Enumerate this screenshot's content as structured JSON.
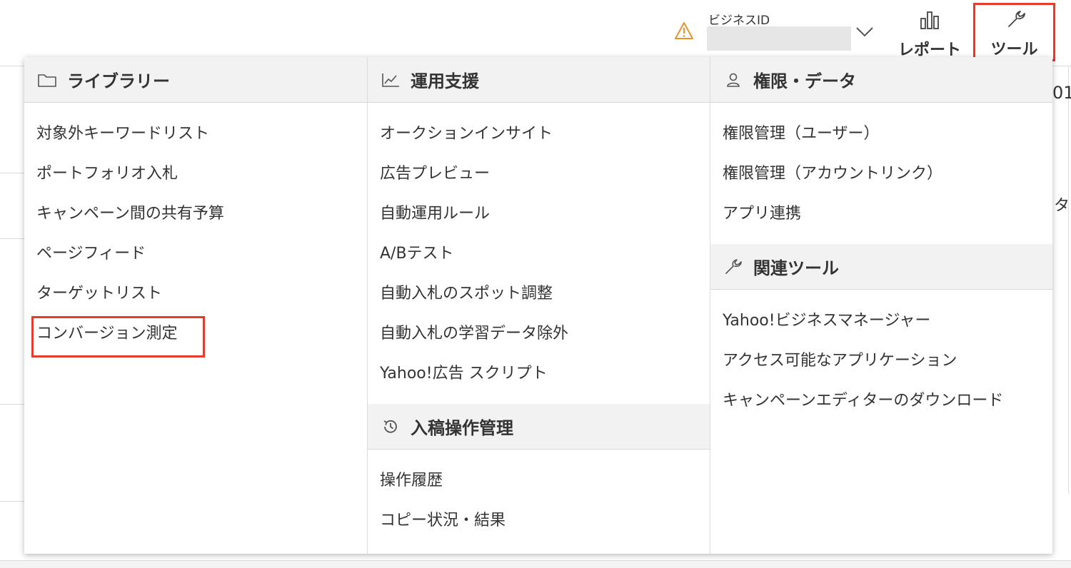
{
  "header": {
    "business_id_label": "ビジネスID",
    "report_label": "レポート",
    "tool_label": "ツール"
  },
  "background": {
    "right_fragment_top": "01",
    "right_fragment_mid": "タ・"
  },
  "menu": {
    "library": {
      "title": "ライブラリー",
      "items": [
        "対象外キーワードリスト",
        "ポートフォリオ入札",
        "キャンペーン間の共有予算",
        "ページフィード",
        "ターゲットリスト",
        "コンバージョン測定"
      ]
    },
    "operation_support": {
      "title": "運用支援",
      "items": [
        "オークションインサイト",
        "広告プレビュー",
        "自動運用ルール",
        "A/Bテスト",
        "自動入札のスポット調整",
        "自動入札の学習データ除外",
        "Yahoo!広告 スクリプト"
      ]
    },
    "submission_management": {
      "title": "入稿操作管理",
      "items": [
        "操作履歴",
        "コピー状況・結果"
      ]
    },
    "permissions_data": {
      "title": "権限・データ",
      "items": [
        "権限管理（ユーザー）",
        "権限管理（アカウントリンク）",
        "アプリ連携"
      ]
    },
    "related_tools": {
      "title": "関連ツール",
      "items": [
        "Yahoo!ビジネスマネージャー",
        "アクセス可能なアプリケーション",
        "キャンペーンエディターのダウンロード"
      ]
    }
  },
  "colors": {
    "highlight": "#e53a2c",
    "warning": "#e8922b",
    "section_bg": "#f2f2f2"
  }
}
